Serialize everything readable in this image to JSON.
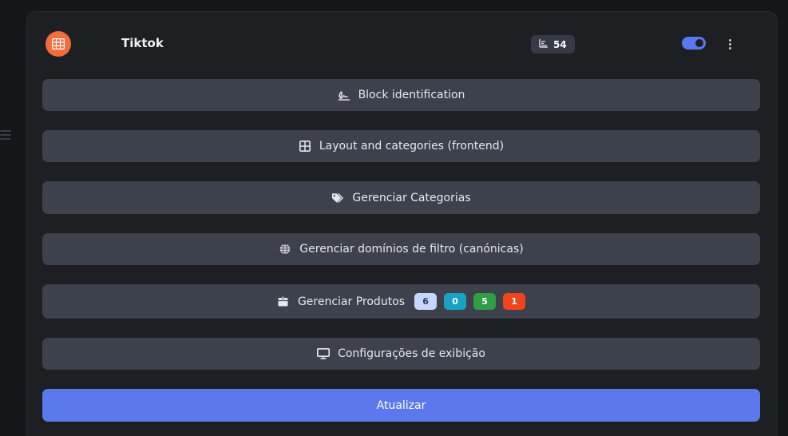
{
  "card": {
    "title": "Tiktok",
    "count": "54",
    "toggle_on": true
  },
  "buttons": {
    "block_identification": "Block identification",
    "layout_categories": "Layout and categories (frontend)",
    "gerenciar_categorias": "Gerenciar Categorias",
    "gerenciar_dominios": "Gerenciar domínios de filtro (canónicas)",
    "gerenciar_produtos": "Gerenciar Produtos",
    "configuracoes_exibicao": "Configurações de exibição",
    "atualizar": "Atualizar"
  },
  "produtos_badges": [
    {
      "value": "6",
      "bg": "#c9d6ff",
      "fg": "#2a3560"
    },
    {
      "value": "0",
      "bg": "#1aa0c2",
      "fg": "#ffffff"
    },
    {
      "value": "5",
      "bg": "#2f9e44",
      "fg": "#ffffff"
    },
    {
      "value": "1",
      "bg": "#f0441c",
      "fg": "#ffffff"
    }
  ],
  "colors": {
    "accent": "#5b79ea",
    "app_icon": "#f26d3d",
    "button_bg": "#3c414c",
    "card_bg": "#1e1f22"
  },
  "icons": {
    "app": "table-grid-icon",
    "count": "bar-chart-icon",
    "menu": "kebab-menu-icon",
    "block_identification": "signature-icon",
    "layout_categories": "grid-icon",
    "gerenciar_categorias": "tags-icon",
    "gerenciar_dominios": "globe-icon",
    "gerenciar_produtos": "box-icon",
    "configuracoes_exibicao": "monitor-icon",
    "side": "drag-handle-icon"
  }
}
